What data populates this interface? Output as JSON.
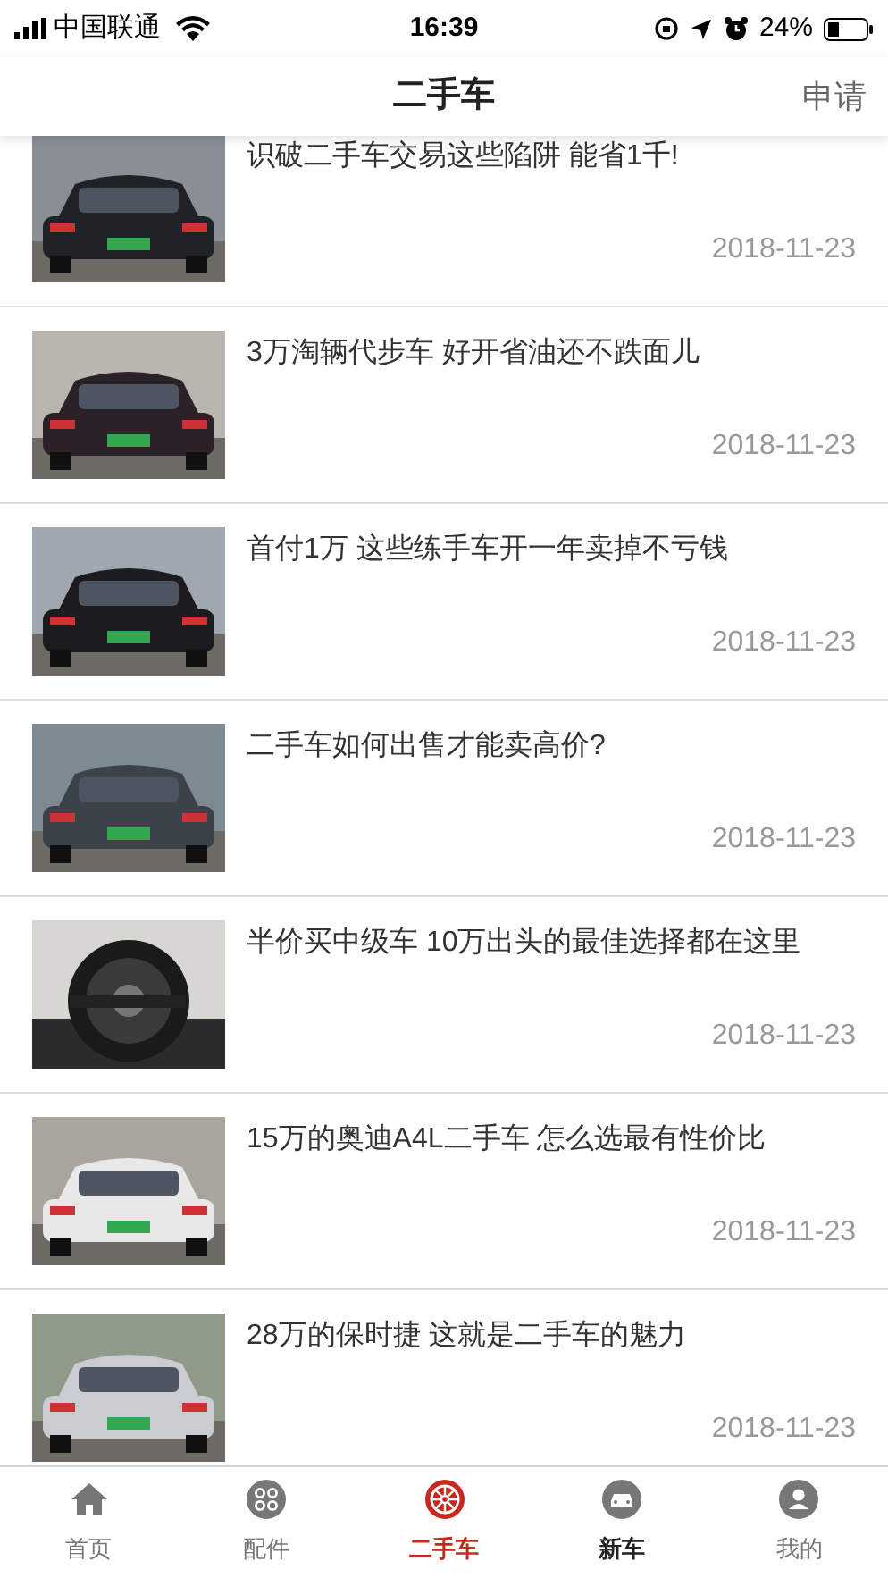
{
  "status_bar": {
    "carrier": "中国联通",
    "time": "16:39",
    "battery": "24%"
  },
  "header": {
    "title": "二手车",
    "action": "申请"
  },
  "articles": [
    {
      "title": "识破二手车交易这些陷阱 能省1千!",
      "date": "2018-11-23"
    },
    {
      "title": "3万淘辆代步车 好开省油还不跌面儿",
      "date": "2018-11-23"
    },
    {
      "title": "首付1万 这些练手车开一年卖掉不亏钱",
      "date": "2018-11-23"
    },
    {
      "title": "二手车如何出售才能卖高价?",
      "date": "2018-11-23"
    },
    {
      "title": "半价买中级车 10万出头的最佳选择都在这里",
      "date": "2018-11-23"
    },
    {
      "title": "15万的奥迪A4L二手车 怎么选最有性价比",
      "date": "2018-11-23"
    },
    {
      "title": "28万的保时捷 这就是二手车的魅力",
      "date": "2018-11-23"
    }
  ],
  "tab_bar": [
    {
      "label": "首页",
      "kind": "home",
      "selected": false,
      "emphasized": false
    },
    {
      "label": "配件",
      "kind": "parts",
      "selected": false,
      "emphasized": false
    },
    {
      "label": "二手车",
      "kind": "wheel",
      "selected": true,
      "emphasized": true
    },
    {
      "label": "新车",
      "kind": "car",
      "selected": false,
      "emphasized": true
    },
    {
      "label": "我的",
      "kind": "user",
      "selected": false,
      "emphasized": false
    }
  ]
}
